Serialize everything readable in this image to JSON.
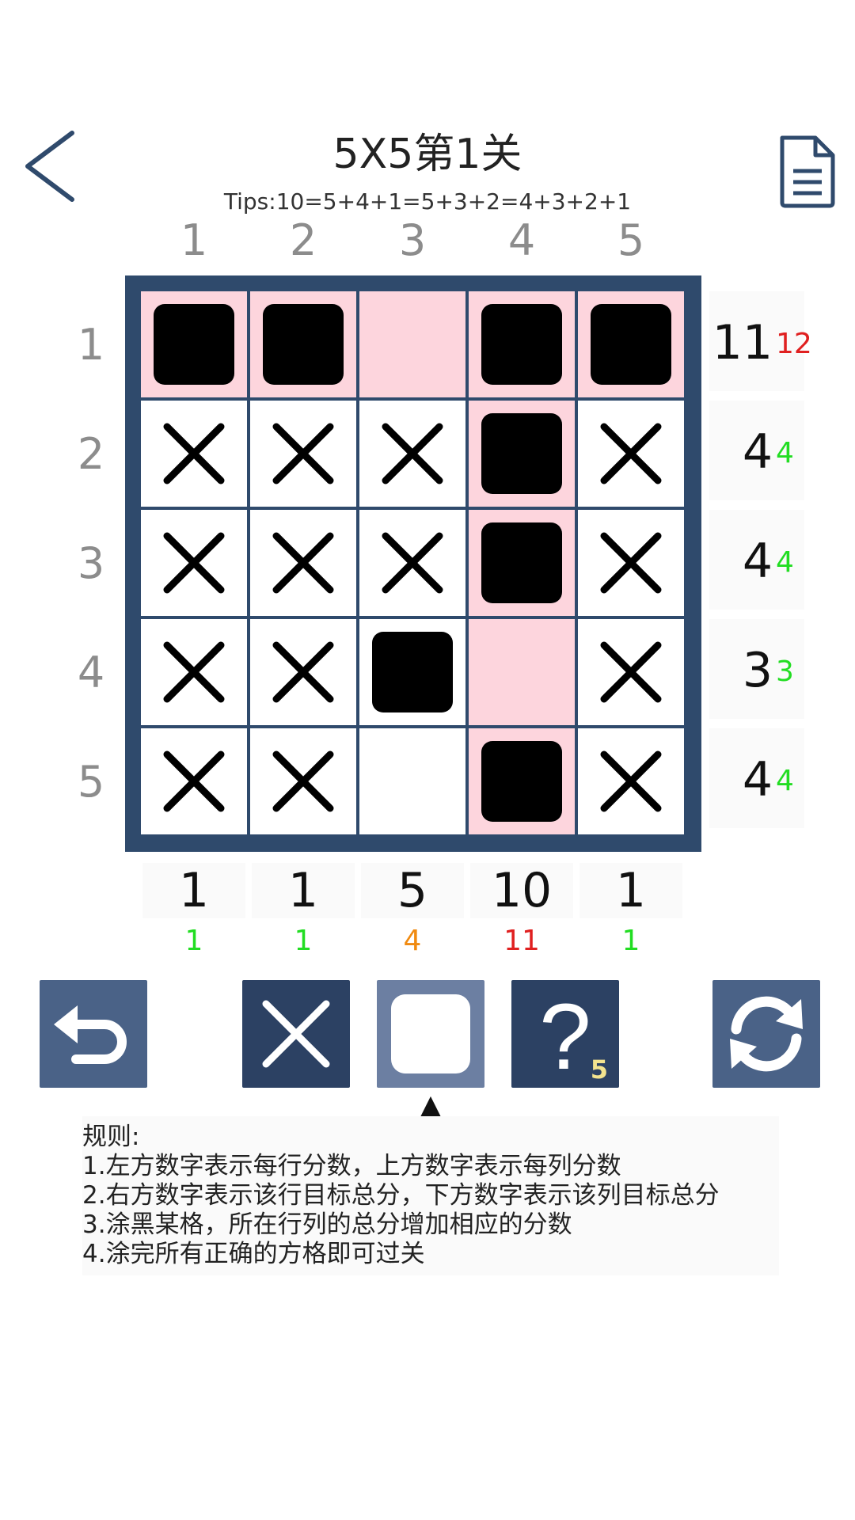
{
  "header": {
    "title": "5X5第1关",
    "tips": "Tips:10=5+4+1=5+3+2=4+3+2+1"
  },
  "columns": [
    "1",
    "2",
    "3",
    "4",
    "5"
  ],
  "rows": [
    "1",
    "2",
    "3",
    "4",
    "5"
  ],
  "grid": [
    [
      "filled",
      "filled",
      "empty",
      "filled",
      "filled"
    ],
    [
      "cross",
      "cross",
      "cross",
      "filled",
      "cross"
    ],
    [
      "cross",
      "cross",
      "cross",
      "filled",
      "cross"
    ],
    [
      "cross",
      "cross",
      "filled",
      "empty",
      "cross"
    ],
    [
      "cross",
      "cross",
      "empty",
      "filled",
      "cross"
    ]
  ],
  "highlight": {
    "row": 1,
    "column": 4,
    "color": "#fdd5dd"
  },
  "row_totals": [
    {
      "current": "11",
      "target": "12",
      "status": "over"
    },
    {
      "current": "4",
      "target": "4",
      "status": "ok"
    },
    {
      "current": "4",
      "target": "4",
      "status": "ok"
    },
    {
      "current": "3",
      "target": "3",
      "status": "ok"
    },
    {
      "current": "4",
      "target": "4",
      "status": "ok"
    }
  ],
  "col_totals": [
    {
      "current": "1",
      "target": "1",
      "status": "ok"
    },
    {
      "current": "1",
      "target": "1",
      "status": "ok"
    },
    {
      "current": "5",
      "target": "4",
      "status": "under"
    },
    {
      "current": "10",
      "target": "11",
      "status": "over"
    },
    {
      "current": "1",
      "target": "1",
      "status": "ok"
    }
  ],
  "status_colors": {
    "ok": "#22dd22",
    "over": "#e02020",
    "under": "#f08a10"
  },
  "toolbar": {
    "undo_icon": "undo-icon",
    "cross_icon": "cross-icon",
    "fill_icon": "square-icon",
    "hint_icon": "question-icon",
    "hint_count": "5",
    "reset_icon": "refresh-icon",
    "selected_tool": "fill",
    "selector_glyph": "▲"
  },
  "rules": {
    "heading": "规则:",
    "items": [
      "1.左方数字表示每行分数，上方数字表示每列分数",
      "2.右方数字表示该行目标总分，下方数字表示该列目标总分",
      "3.涂黑某格，所在行列的总分增加相应的分数",
      "4.涂完所有正确的方格即可过关"
    ]
  },
  "colors": {
    "board": "#2f4a6c",
    "button": "#4a6287",
    "button_dark": "#2c4163",
    "button_selected": "#6c7fa2"
  }
}
